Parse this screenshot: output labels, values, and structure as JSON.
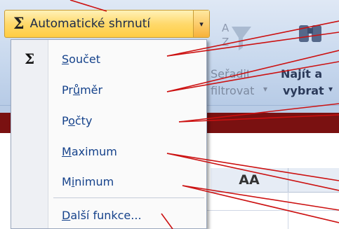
{
  "autosum": {
    "symbol": "Σ",
    "label": "Automatické shrnutí",
    "arrow": "▾"
  },
  "ribbon": {
    "sort_label": "Seřadit",
    "filter_label": "filtrovat",
    "find_label_top": "Najít a",
    "find_label_bottom": "vybrat",
    "dropdown_glyph": "▾"
  },
  "menu": {
    "sigma": "Σ",
    "items": [
      {
        "label_pre": "",
        "accel": "S",
        "label_post": "oučet"
      },
      {
        "label_pre": "Pr",
        "accel": "ů",
        "label_post": "měr"
      },
      {
        "label_pre": "P",
        "accel": "o",
        "label_post": "čty"
      },
      {
        "label_pre": "",
        "accel": "M",
        "label_post": "aximum"
      },
      {
        "label_pre": "M",
        "accel": "i",
        "label_post": "nimum"
      },
      {
        "label_pre": "",
        "accel": "D",
        "label_post": "alší funkce..."
      }
    ]
  },
  "sheet": {
    "column_aa": "AA"
  },
  "colors": {
    "background": "#7a1111",
    "callout_line": "#cc1111",
    "menu_text": "#15428b"
  }
}
